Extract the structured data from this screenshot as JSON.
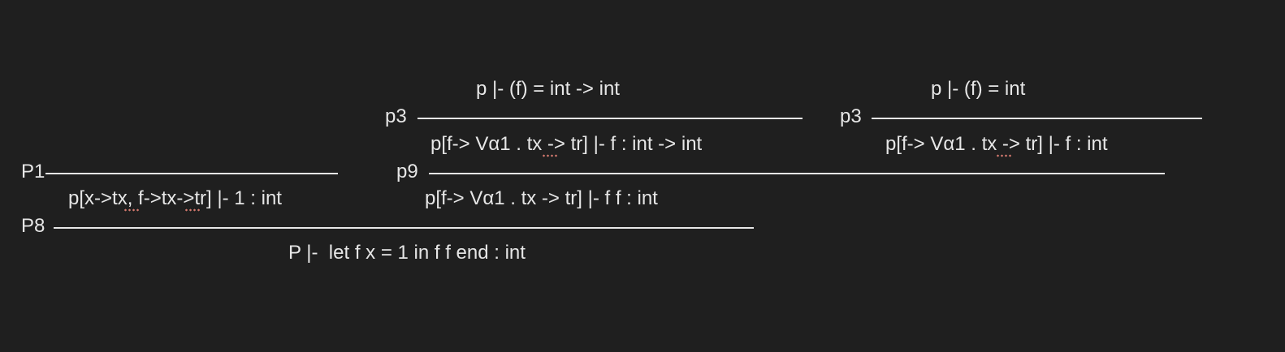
{
  "proof": {
    "p3_left": {
      "premise": "p |- (f) = int -> int",
      "label": "p3",
      "conclusion": "p[f-> Vα1 . tx -> tr] |- f : int -> int"
    },
    "p3_right": {
      "premise": "p |- (f) = int",
      "label": "p3",
      "conclusion": "p[f-> Vα1 . tx -> tr] |- f : int"
    },
    "p1": {
      "label": "P1",
      "conclusion": "p[x->tx, f->tx->tr] |- 1 : int"
    },
    "p9": {
      "label": "p9",
      "conclusion": "p[f-> Vα1 . tx -> tr] |- f f : int"
    },
    "p8": {
      "label": "P8",
      "conclusion": "P |-  let f x = 1 in f f end : int"
    }
  },
  "colors": {
    "background": "#1f1f1f",
    "text": "#e6e6e6",
    "spellcheck": "#d67a6f"
  }
}
